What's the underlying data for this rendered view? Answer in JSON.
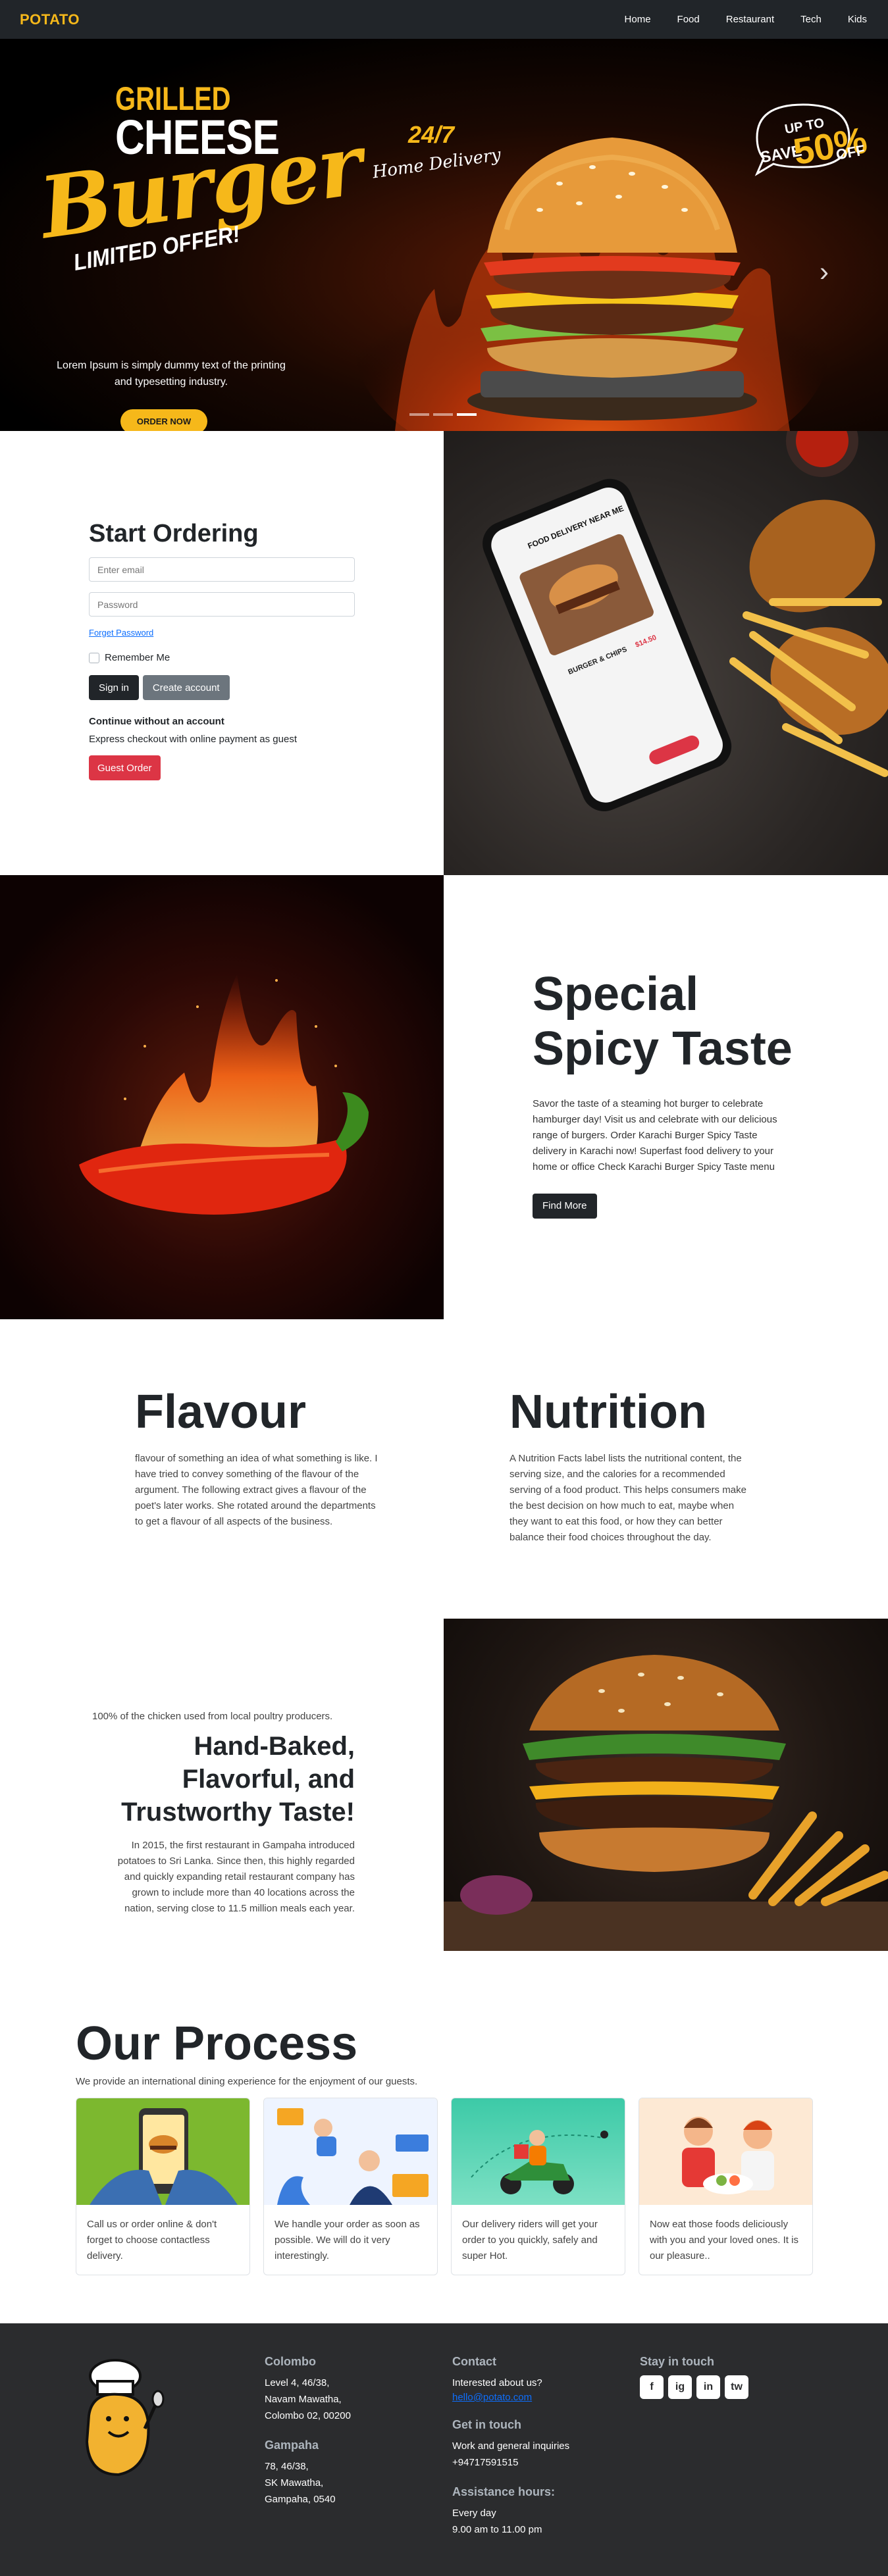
{
  "nav": {
    "brand": "POTATO",
    "links": [
      "Home",
      "Food",
      "Restaurant",
      "Tech",
      "Kids"
    ]
  },
  "hero": {
    "line1": "GRILLED",
    "line2": "CHEESE",
    "line3": "Burger",
    "line4": "LIMITED OFFER!",
    "tag_247": "24/7",
    "tag_home": "Home Delivery",
    "badge_up": "UP TO",
    "badge_save": "SAVE",
    "badge_pct": "50%",
    "badge_off": "OFF",
    "description": "Lorem Ipsum is simply dummy text of the printing and typesetting industry.",
    "cta": "ORDER NOW",
    "slides_total": 3,
    "active_slide": 3
  },
  "order": {
    "title": "Start Ordering",
    "email_placeholder": "Enter email",
    "password_placeholder": "Password",
    "forgot": "Forget Password",
    "remember": "Remember Me",
    "signin": "Sign in",
    "create": "Create account",
    "guest_head": "Continue without an account",
    "guest_desc": "Express checkout with online payment as guest",
    "guest_btn": "Guest Order",
    "phone_header": "FOOD DELIVERY NEAR ME",
    "phone_item": "BURGER & CHIPS",
    "phone_price": "$14.50"
  },
  "spicy": {
    "title_1": "Special",
    "title_2": "Spicy Taste",
    "description": "Savor the taste of a steaming hot burger to celebrate hamburger day! Visit us and celebrate with our delicious range of burgers. Order Karachi Burger Spicy Taste delivery in Karachi now! Superfast food delivery to your home or office Check Karachi Burger Spicy Taste menu",
    "button": "Find More"
  },
  "flavour": {
    "title": "Flavour",
    "text": "flavour of something an idea of what something is like. I have tried to convey something of the flavour of the argument. The following extract gives a flavour of the poet's later works. She rotated around the departments to get a flavour of all aspects of the business."
  },
  "nutrition": {
    "title": "Nutrition",
    "text": "A Nutrition Facts label lists the nutritional content, the serving size, and the calories for a recommended serving of a food product. This helps consumers make the best decision on how much to eat, maybe when they want to eat this food, or how they can better balance their food choices throughout the day."
  },
  "baked": {
    "kicker": "100% of the chicken used from local poultry producers.",
    "title_1": "Hand-Baked,",
    "title_2": "Flavorful, and",
    "title_3": "Trustworthy Taste!",
    "text": "In 2015, the first restaurant in Gampaha introduced potatoes to Sri Lanka. Since then, this highly regarded and quickly expanding retail restaurant company has grown to include more than 40 locations across the nation, serving close to 11.5 million meals each year."
  },
  "process": {
    "title": "Our Process",
    "subtitle": "We provide an international dining experience for the enjoyment of our guests.",
    "cards": [
      {
        "text": "Call us or order online & don't forget to choose contactless delivery."
      },
      {
        "text": "We handle your order as soon as possible. We will do it very interestingly."
      },
      {
        "text": "Our delivery riders will get your order to you quickly, safely and super Hot."
      },
      {
        "text": "Now eat those foods deliciously with you and your loved ones. It is our pleasure.."
      }
    ]
  },
  "footer": {
    "colombo_title": "Colombo",
    "colombo_1": "Level 4, 46/38,",
    "colombo_2": "Navam Mawatha,",
    "colombo_3": "Colombo 02, 00200",
    "gampaha_title": "Gampaha",
    "gampaha_1": "78, 46/38,",
    "gampaha_2": "SK Mawatha,",
    "gampaha_3": "Gampaha, 0540",
    "contact_title": "Contact",
    "contact_text": "Interested about us?",
    "contact_email": "hello@potato.com",
    "touch_title": "Get in touch",
    "touch_text": "Work and general inquiries",
    "touch_phone": "+94717591515",
    "hours_title": "Assistance hours:",
    "hours_1": "Every day",
    "hours_2": "9.00 am to 11.00 pm",
    "stay_title": "Stay in touch",
    "social": [
      "f",
      "ig",
      "in",
      "tw"
    ]
  },
  "colors": {
    "accent": "#f6b81a",
    "dark": "#212529",
    "danger": "#dc3545",
    "footer_bg": "#2b2c2e"
  }
}
